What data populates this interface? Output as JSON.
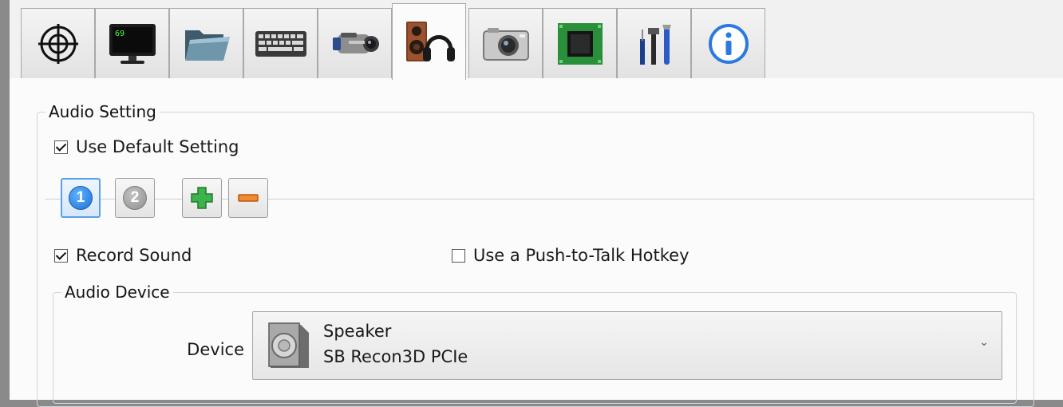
{
  "tabs": [
    {
      "icon": "crosshair-icon",
      "active": false
    },
    {
      "icon": "monitor-icon",
      "active": false,
      "screen_text": "69"
    },
    {
      "icon": "folder-icon",
      "active": false
    },
    {
      "icon": "keyboard-icon",
      "active": false
    },
    {
      "icon": "camcorder-icon",
      "active": false
    },
    {
      "icon": "speaker-headphones-icon",
      "active": true
    },
    {
      "icon": "camera-icon",
      "active": false
    },
    {
      "icon": "chip-icon",
      "active": false
    },
    {
      "icon": "tools-icon",
      "active": false
    },
    {
      "icon": "info-icon",
      "active": false
    }
  ],
  "audio_setting": {
    "legend": "Audio Setting",
    "use_default_label": "Use Default Setting",
    "use_default_checked": true,
    "pages": [
      {
        "label": "1",
        "selected": true
      },
      {
        "label": "2",
        "selected": false
      }
    ],
    "add_icon": "plus-icon",
    "remove_icon": "minus-icon",
    "record_sound_label": "Record Sound",
    "record_sound_checked": true,
    "push_to_talk_label": "Use a Push-to-Talk Hotkey",
    "push_to_talk_checked": false
  },
  "audio_device": {
    "legend": "Audio Device",
    "device_label": "Device",
    "device_icon": "speaker-icon",
    "device_type": "Speaker",
    "device_name": "SB Recon3D PCIe"
  },
  "colors": {
    "accent_blue": "#1d72d8",
    "add_green": "#3cb44b",
    "remove_orange": "#f08a30"
  }
}
